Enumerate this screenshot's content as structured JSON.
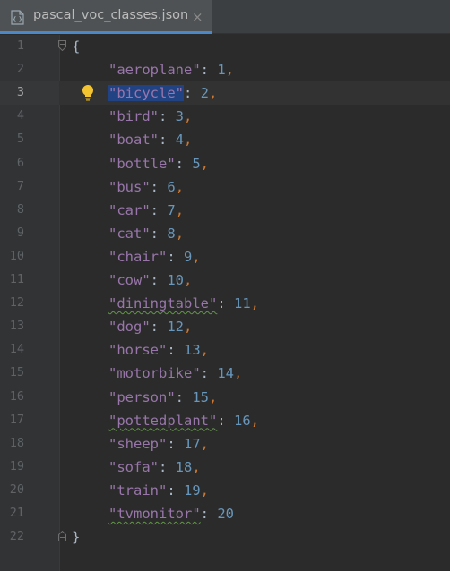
{
  "tab": {
    "filename": "pascal_voc_classes.json",
    "close_glyph": "×",
    "icon": "json-file-icon"
  },
  "editor": {
    "current_line": 3,
    "open_brace": "{",
    "close_brace": "}",
    "lines": [
      {
        "num": "1",
        "kind": "open"
      },
      {
        "num": "2",
        "key": "\"aeroplane\"",
        "value": "1",
        "comma": true
      },
      {
        "num": "3",
        "key": "\"bicycle\"",
        "value": "2",
        "comma": true,
        "selected": true,
        "intention_icon": "lightbulb-icon"
      },
      {
        "num": "4",
        "key": "\"bird\"",
        "value": "3",
        "comma": true
      },
      {
        "num": "5",
        "key": "\"boat\"",
        "value": "4",
        "comma": true
      },
      {
        "num": "6",
        "key": "\"bottle\"",
        "value": "5",
        "comma": true
      },
      {
        "num": "7",
        "key": "\"bus\"",
        "value": "6",
        "comma": true
      },
      {
        "num": "8",
        "key": "\"car\"",
        "value": "7",
        "comma": true
      },
      {
        "num": "9",
        "key": "\"cat\"",
        "value": "8",
        "comma": true
      },
      {
        "num": "10",
        "key": "\"chair\"",
        "value": "9",
        "comma": true
      },
      {
        "num": "11",
        "key": "\"cow\"",
        "value": "10",
        "comma": true
      },
      {
        "num": "12",
        "key": "\"diningtable\"",
        "value": "11",
        "comma": true,
        "typo": true
      },
      {
        "num": "13",
        "key": "\"dog\"",
        "value": "12",
        "comma": true
      },
      {
        "num": "14",
        "key": "\"horse\"",
        "value": "13",
        "comma": true
      },
      {
        "num": "15",
        "key": "\"motorbike\"",
        "value": "14",
        "comma": true
      },
      {
        "num": "16",
        "key": "\"person\"",
        "value": "15",
        "comma": true
      },
      {
        "num": "17",
        "key": "\"pottedplant\"",
        "value": "16",
        "comma": true,
        "typo": true
      },
      {
        "num": "18",
        "key": "\"sheep\"",
        "value": "17",
        "comma": true
      },
      {
        "num": "19",
        "key": "\"sofa\"",
        "value": "18",
        "comma": true
      },
      {
        "num": "20",
        "key": "\"train\"",
        "value": "19",
        "comma": true
      },
      {
        "num": "21",
        "key": "\"tvmonitor\"",
        "value": "20",
        "comma": false,
        "typo": true
      },
      {
        "num": "22",
        "kind": "close"
      }
    ]
  },
  "colors": {
    "background": "#2b2b2b",
    "gutter": "#313335",
    "key": "#9876aa",
    "number": "#6897bb",
    "punctuation": "#cc7832",
    "selection": "#214283",
    "tab_underline": "#4a88c7"
  }
}
